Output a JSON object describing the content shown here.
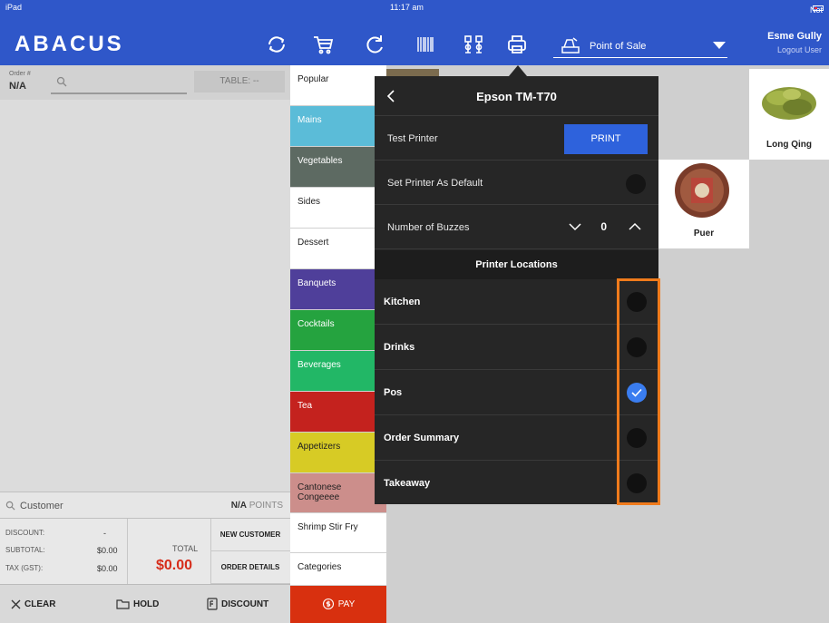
{
  "status_bar": {
    "device": "iPad",
    "time": "11:17 am",
    "battery": "Not Charging"
  },
  "header": {
    "logo": "ABACUS",
    "mode": "Point of Sale",
    "user_name": "Esme Gully",
    "logout": "Logout User",
    "icons": [
      "refresh-circle-icon",
      "cart-icon",
      "reload-icon",
      "barcode-icon",
      "scale-icon",
      "printer-icon",
      "register-icon"
    ]
  },
  "order": {
    "order_label": "Order #",
    "order_number": "N/A",
    "search_placeholder": "",
    "table": "TABLE: --",
    "customer_label": "Customer",
    "points_value": "N/A",
    "points_label": "POINTS",
    "discount_label": "DISCOUNT:",
    "discount_value": "-",
    "subtotal_label": "SUBTOTAL:",
    "subtotal_value": "$0.00",
    "tax_label": "TAX (GST):",
    "tax_value": "$0.00",
    "total_label": "TOTAL",
    "total_value": "$0.00",
    "new_customer": "NEW CUSTOMER",
    "order_details": "ORDER DETAILS",
    "clear": "CLEAR",
    "hold": "HOLD",
    "discount": "DISCOUNT"
  },
  "categories": [
    {
      "label": "Popular",
      "color": "#ffffff"
    },
    {
      "label": "Mains",
      "color": "#5bbcd8"
    },
    {
      "label": "Vegetables",
      "color": "#5d6a62"
    },
    {
      "label": "Sides",
      "color": "#ffffff"
    },
    {
      "label": "Dessert",
      "color": "#ffffff"
    },
    {
      "label": "Banquets",
      "color": "#4f3f9a"
    },
    {
      "label": "Cocktails",
      "color": "#25a33f"
    },
    {
      "label": "Beverages",
      "color": "#22b766"
    },
    {
      "label": "Tea",
      "color": "#c4221e"
    },
    {
      "label": "Appetizers",
      "color": "#d7cb25"
    },
    {
      "label": "Cantonese Congeeee",
      "color": "#cc8e8b"
    },
    {
      "label": "Shrimp Stir Fry",
      "color": "#ffffff"
    },
    {
      "label": "Categories",
      "color": "#ffffff"
    }
  ],
  "pay_label": "PAY",
  "products": [
    {
      "label": "Long Qing"
    },
    {
      "label": "Puer"
    }
  ],
  "printer_popup": {
    "title": "Epson TM-T70",
    "test_printer": "Test Printer",
    "print_button": "PRINT",
    "set_default": "Set Printer As Default",
    "buzzes_label": "Number of Buzzes",
    "buzzes_value": "0",
    "locations_header": "Printer Locations",
    "locations": [
      {
        "label": "Kitchen",
        "checked": false
      },
      {
        "label": "Drinks",
        "checked": false
      },
      {
        "label": "Pos",
        "checked": true
      },
      {
        "label": "Order Summary",
        "checked": false
      },
      {
        "label": "Takeaway",
        "checked": false
      }
    ]
  },
  "colors": {
    "primary": "#2f57c9",
    "pay": "#d8300f",
    "total": "#d62c1a",
    "highlight": "#f07b1c",
    "check": "#3a7df0"
  }
}
